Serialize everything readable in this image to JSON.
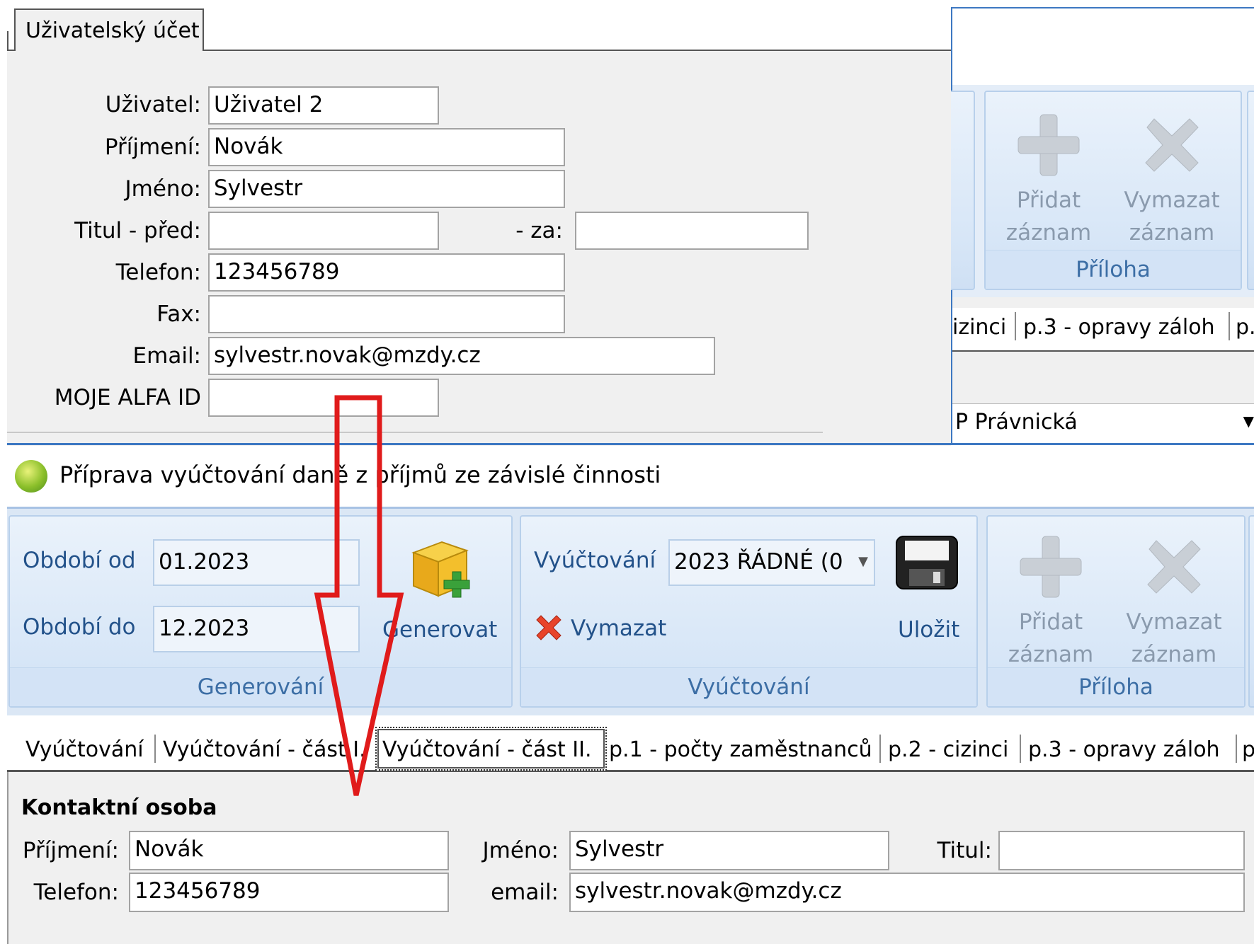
{
  "user_account": {
    "tab_label": "Uživatelský účet",
    "fields": {
      "user_label": "Uživatel:",
      "user_value": "Uživatel 2",
      "surname_label": "Příjmení:",
      "surname_value": "Novák",
      "name_label": "Jméno:",
      "name_value": "Sylvestr",
      "title_before_label": "Titul - před:",
      "title_before_value": "",
      "title_after_label": "- za:",
      "title_after_value": "",
      "phone_label": "Telefon:",
      "phone_value": "123456789",
      "fax_label": "Fax:",
      "fax_value": "",
      "email_label": "Email:",
      "email_value": "sylvestr.novak@mzdy.cz",
      "alfa_label": "MOJE ALFA ID",
      "alfa_value": ""
    }
  },
  "bg_window": {
    "add_label_1": "Přidat",
    "add_label_2": "záznam",
    "delete_label_1": "Vymazat",
    "delete_label_2": "záznam",
    "group_caption": "Příloha",
    "tabs_partial": [
      "izinci",
      "p.3 - opravy záloh",
      "p."
    ],
    "select_value": "P Právnická"
  },
  "main_window": {
    "title": "Příprava vyúčtování daně z příjmů ze závislé činnosti",
    "generovani": {
      "from_label": "Období od",
      "from_value": "01.2023",
      "to_label": "Období do",
      "to_value": "12.2023",
      "generate_label": "Generovat",
      "group_caption": "Generování"
    },
    "vyuctovani": {
      "select_label": "Vyúčtování",
      "select_value": "2023 ŘÁDNÉ (0",
      "delete_label": "Vymazat",
      "save_label": "Uložit",
      "group_caption": "Vyúčtování"
    },
    "priloha": {
      "add_label_1": "Přidat",
      "add_label_2": "záznam",
      "delete_label_1": "Vymazat",
      "delete_label_2": "záznam",
      "group_caption": "Příloha"
    },
    "tabs": [
      "Vyúčtování",
      "Vyúčtování - část I.",
      "Vyúčtování - část II.",
      "p.1 - počty zaměstnanců",
      "p.2 - cizinci",
      "p.3 - opravy záloh",
      "p"
    ],
    "active_tab": "Vyúčtování - část II.",
    "contact": {
      "heading": "Kontaktní osoba",
      "surname_label": "Příjmení:",
      "surname_value": "Novák",
      "phone_label": "Telefon:",
      "phone_value": "123456789",
      "name_label": "Jméno:",
      "name_value": "Sylvestr",
      "email_label": "email:",
      "email_value": "sylvestr.novak@mzdy.cz",
      "title_label": "Titul:",
      "title_value": ""
    }
  },
  "colors": {
    "annotation_arrow": "#e01b1b",
    "ribbon_text": "#23528a",
    "ribbon_bg": "#d7e6f7",
    "panel_bg": "#f0f0f0"
  }
}
